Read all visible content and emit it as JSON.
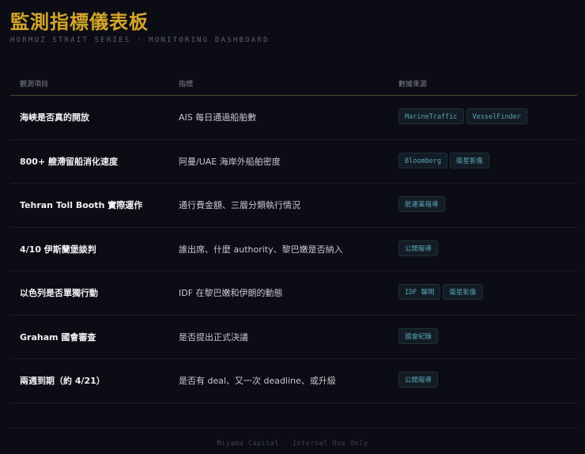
{
  "header": {
    "title": "監測指標儀表板",
    "subtitle": "HORMUZ STRAIT SERIES · MONITORING DASHBOARD"
  },
  "table": {
    "columns": [
      "觀測項目",
      "指標",
      "數據來源"
    ],
    "rows": [
      {
        "item": "海峽是否真的開放",
        "indicator": "AIS 每日通過船舶數",
        "sources": [
          "MarineTraffic",
          "VesselFinder"
        ]
      },
      {
        "item": "800+ 艘滯留船消化速度",
        "indicator": "阿曼/UAE 海岸外船舶密度",
        "sources": [
          "Bloomberg",
          "衛星影像"
        ]
      },
      {
        "item": "Tehran Toll Booth 實際運作",
        "indicator": "通行費金額、三層分類執行情況",
        "sources": [
          "航運業報導"
        ]
      },
      {
        "item": "4/10 伊斯蘭堡談判",
        "indicator": "誰出席、什麼 authority、黎巴嫩是否納入",
        "sources": [
          "公開報導"
        ]
      },
      {
        "item": "以色列是否單獨行動",
        "indicator": "IDF 在黎巴嫩和伊朗的動態",
        "sources": [
          "IDF 聲明",
          "衛星影像"
        ]
      },
      {
        "item": "Graham 國會審查",
        "indicator": "是否提出正式決議",
        "sources": [
          "國會紀錄"
        ]
      },
      {
        "item": "兩週到期（約 4/21）",
        "indicator": "是否有 deal、又一次 deadline、或升級",
        "sources": [
          "公開報導"
        ]
      }
    ]
  },
  "footer": {
    "text": "Miyama Capital · Internal Use Only"
  }
}
